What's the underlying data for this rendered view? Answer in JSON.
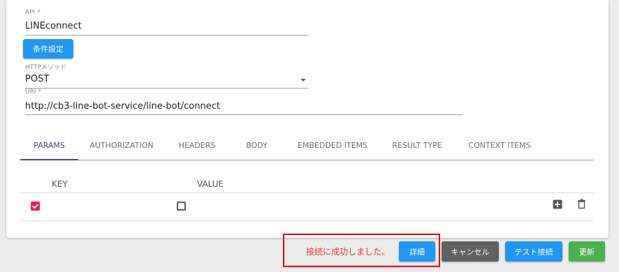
{
  "form": {
    "api": {
      "label": "API *",
      "value": "LINEconnect"
    },
    "condition_button": "条件設定",
    "http_method": {
      "label": "HTTPメソッド",
      "value": "POST"
    },
    "uri": {
      "label": "URI *",
      "value": "http://cb3-line-bot-service/line-bot/connect"
    }
  },
  "tabs": [
    {
      "label": "PARAMS",
      "active": true
    },
    {
      "label": "AUTHORIZATION",
      "active": false
    },
    {
      "label": "HEADERS",
      "active": false
    },
    {
      "label": "BODY",
      "active": false
    },
    {
      "label": "EMBEDDED ITEMS",
      "active": false
    },
    {
      "label": "RESULT TYPE",
      "active": false
    },
    {
      "label": "CONTEXT ITEMS",
      "active": false
    }
  ],
  "params_table": {
    "headers": {
      "key": "KEY",
      "value": "VALUE"
    },
    "rows": [
      {
        "enabled": true,
        "value_checked": false,
        "key": "",
        "value": ""
      }
    ]
  },
  "footer": {
    "message": "接続に成功しました。",
    "detail_button": "詳細",
    "cancel_button": "キャンセル",
    "test_button": "テスト接続",
    "update_button": "更新"
  },
  "colors": {
    "primary": "#2196f3",
    "tab_active": "#3a4a8c",
    "checkbox_checked": "#e91e63",
    "success_button": "#4caf50",
    "cancel_button": "#616161",
    "message_text": "#e53935",
    "highlight_border": "#e00000"
  },
  "icons": [
    "check-icon",
    "chevron-down-icon",
    "add-box-icon",
    "trash-icon"
  ]
}
